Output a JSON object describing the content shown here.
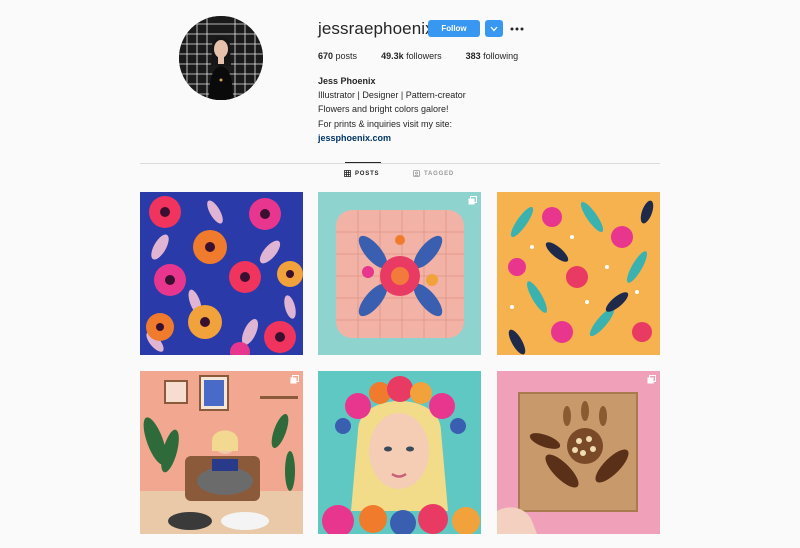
{
  "profile": {
    "username": "jessraephoenix",
    "follow_label": "Follow",
    "stats": {
      "posts_count": "670",
      "posts_label": "posts",
      "followers_count": "49.3k",
      "followers_label": "followers",
      "following_count": "383",
      "following_label": "following"
    },
    "bio": {
      "name": "Jess Phoenix",
      "line1": "Illustrator | Designer | Pattern-creator",
      "line2": "Flowers and bright colors galore!",
      "line3": "For prints & inquiries visit my site:",
      "link": "jessphoenix.com"
    }
  },
  "tabs": [
    {
      "label": "POSTS",
      "icon": "grid-icon",
      "active": true
    },
    {
      "label": "TAGGED",
      "icon": "tag-icon",
      "active": false
    }
  ],
  "posts": [
    {
      "subject": "blue floral pattern",
      "multiple": false
    },
    {
      "subject": "pink quilted embroidered pouch",
      "multiple": true
    },
    {
      "subject": "orange and teal floral pattern",
      "multiple": false
    },
    {
      "subject": "woman reading with cats",
      "multiple": true
    },
    {
      "subject": "blonde woman flower crown portrait",
      "multiple": false
    },
    {
      "subject": "wooden inlay flower art",
      "multiple": true
    }
  ],
  "colors": {
    "accent": "#3897f0",
    "link": "#003569",
    "divider": "#dbdbdb",
    "background": "#fafafa"
  }
}
